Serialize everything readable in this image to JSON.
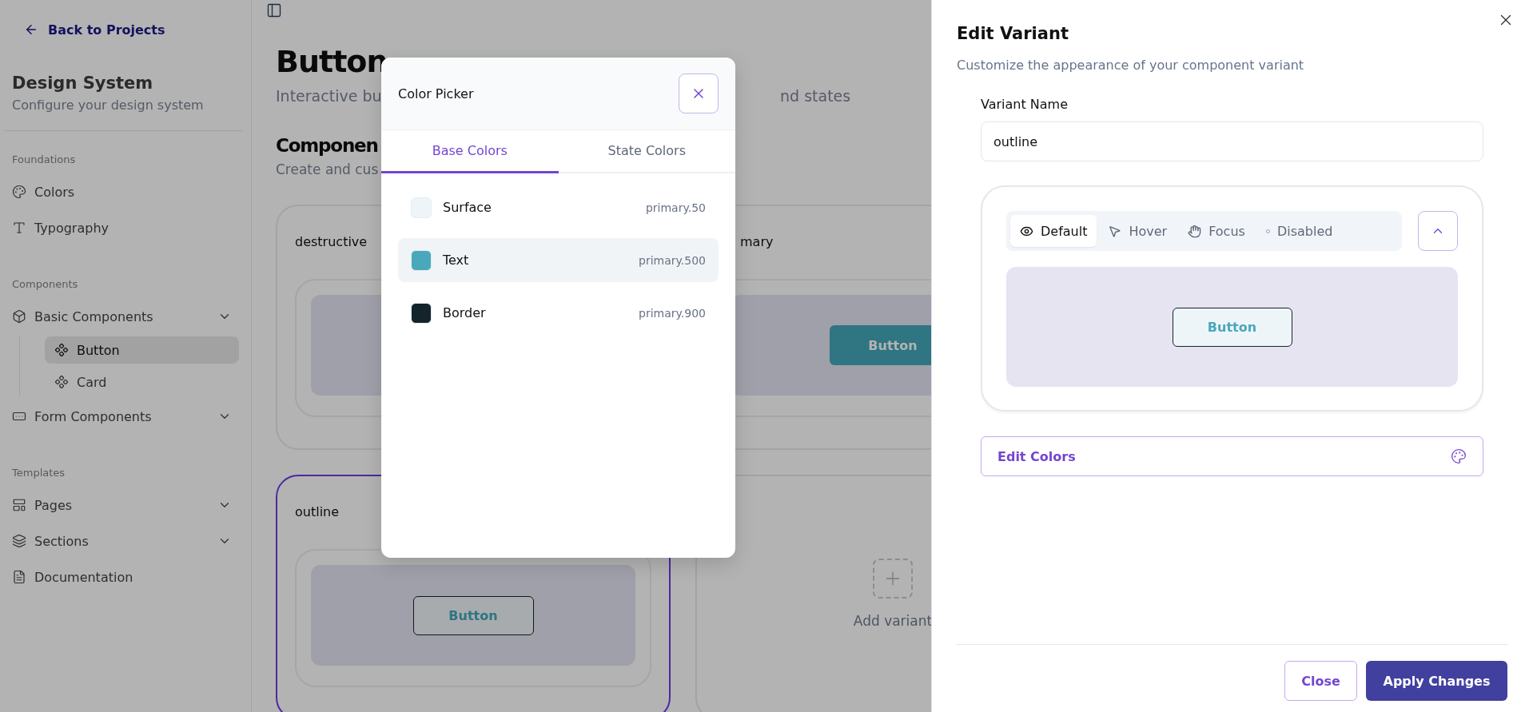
{
  "sidebar": {
    "back_link": "Back to Projects",
    "title": "Design System",
    "subtitle": "Configure your design system",
    "sections": [
      {
        "heading": "Foundations",
        "items": [
          {
            "label": "Colors",
            "kind": "palette",
            "selected": false
          },
          {
            "label": "Typography",
            "kind": "type",
            "selected": false
          }
        ]
      },
      {
        "heading": "Components",
        "items": [
          {
            "label": "Basic Components",
            "kind": "box",
            "selected": false,
            "collapsible": true,
            "expanded": true,
            "children": [
              {
                "label": "Button",
                "kind": "component",
                "selected": true
              },
              {
                "label": "Card",
                "kind": "component",
                "selected": false
              }
            ]
          },
          {
            "label": "Form Components",
            "kind": "form",
            "selected": false,
            "collapsible": true
          }
        ]
      },
      {
        "heading": "Templates",
        "items": [
          {
            "label": "Pages",
            "kind": "layout",
            "selected": false,
            "collapsible": true
          },
          {
            "label": "Sections",
            "kind": "layers",
            "selected": false,
            "collapsible": true
          },
          {
            "label": "Documentation",
            "kind": "document",
            "selected": false
          }
        ]
      }
    ]
  },
  "main": {
    "title": "Button",
    "subtitle_parts": [
      "Interactive bu",
      "nd states"
    ],
    "section_title": "Componen",
    "section_subtitle": "Create and cus",
    "variants": [
      {
        "kind": "variant",
        "name": "destructive",
        "selected": false
      },
      {
        "kind": "partial",
        "name": "mary",
        "selected": false,
        "preview_button": {
          "kind": "filled",
          "label": "Button"
        }
      },
      {
        "kind": "variant",
        "name": "outline",
        "selected": true,
        "preview_button": {
          "kind": "outline",
          "label": "Button"
        }
      },
      {
        "kind": "add",
        "label": "Add variant"
      }
    ]
  },
  "color_picker": {
    "title": "Color Picker",
    "tabs": [
      {
        "label": "Base Colors",
        "selected": true
      },
      {
        "label": "State Colors",
        "selected": false
      }
    ],
    "colors": [
      {
        "name": "Surface",
        "token": "primary.50",
        "color": "#eef5f8",
        "selected": false
      },
      {
        "name": "Text",
        "token": "primary.500",
        "color": "#4aa8bc",
        "selected": true
      },
      {
        "name": "Border",
        "token": "primary.900",
        "color": "#13242a",
        "selected": false
      }
    ]
  },
  "edit_panel": {
    "title": "Edit Variant",
    "subtitle": "Customize the appearance of your component variant",
    "name_label": "Variant Name",
    "name_value": "outline",
    "states": [
      {
        "label": "Default",
        "kind": "default",
        "selected": true
      },
      {
        "label": "Hover",
        "kind": "hover",
        "selected": false
      },
      {
        "label": "Focus",
        "kind": "focus",
        "selected": false
      },
      {
        "label": "Disabled",
        "kind": "disabled",
        "selected": false
      }
    ],
    "preview_expanded": true,
    "preview_button": "Button",
    "edit_colors": "Edit Colors",
    "close_button": "Close",
    "apply_button": "Apply Changes"
  }
}
